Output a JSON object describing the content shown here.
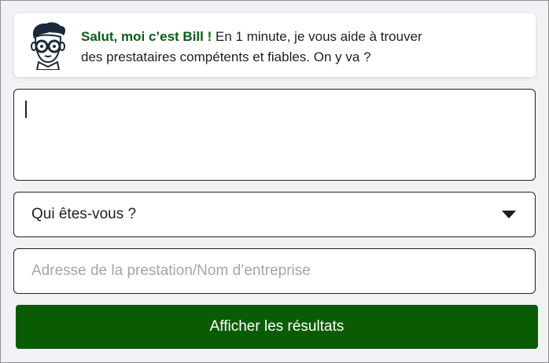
{
  "intro": {
    "name": "Salut, moi c’est Bill !",
    "message_line1": "En 1 minute, je vous aide à trouver",
    "message_line2": "des prestataires compétents et fiables. On y va ?"
  },
  "avatar": {
    "icon": "bill-avatar-icon"
  },
  "request_field": {
    "value": ""
  },
  "who_select": {
    "selected": "Qui êtes-vous ?",
    "icon": "caret-down-icon"
  },
  "address_field": {
    "placeholder": "Adresse de la prestation/Nom d’entreprise",
    "value": ""
  },
  "submit": {
    "label": "Afficher les résultats"
  },
  "colors": {
    "brand_green": "#0a5c04",
    "name_green": "#0a5c16",
    "background": "#f1f2f4"
  }
}
